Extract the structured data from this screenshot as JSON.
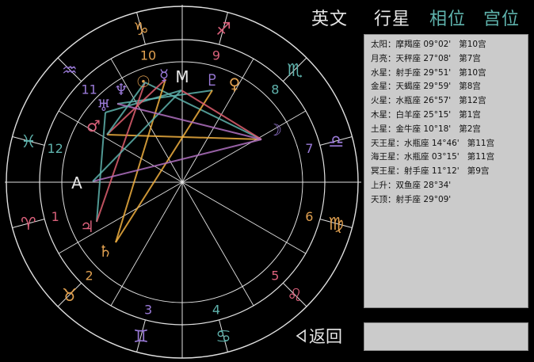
{
  "tabs": {
    "english": "英文",
    "planets": "行星",
    "aspects": "相位",
    "houses": "宫位"
  },
  "rows": [
    {
      "planet": "太阳",
      "sign": "摩羯座",
      "deg": "09°02'",
      "house": "第10宫"
    },
    {
      "planet": "月亮",
      "sign": "天秤座",
      "deg": "27°08'",
      "house": "第7宫"
    },
    {
      "planet": "水星",
      "sign": "射手座",
      "deg": "29°51'",
      "house": "第10宫"
    },
    {
      "planet": "金星",
      "sign": "天蝎座",
      "deg": "29°59'",
      "house": "第8宫"
    },
    {
      "planet": "火星",
      "sign": "水瓶座",
      "deg": "26°57'",
      "house": "第12宫"
    },
    {
      "planet": "木星",
      "sign": "白羊座",
      "deg": "25°15'",
      "house": "第1宫"
    },
    {
      "planet": "土星",
      "sign": "金牛座",
      "deg": "10°18'",
      "house": "第2宫"
    },
    {
      "planet": "天王星",
      "sign": "水瓶座",
      "deg": "14°46'",
      "house": "第11宫"
    },
    {
      "planet": "海王星",
      "sign": "水瓶座",
      "deg": "03°15'",
      "house": "第11宫"
    },
    {
      "planet": "冥王星",
      "sign": "射手座",
      "deg": "11°12'",
      "house": "第9宫"
    },
    {
      "planet": "上升",
      "sign": "双鱼座",
      "deg": "28°34'",
      "house": ""
    },
    {
      "planet": "天顶",
      "sign": "射手座",
      "deg": "29°09'",
      "house": ""
    }
  ],
  "back_label": "返回",
  "chart": {
    "house_numbers": [
      "1",
      "2",
      "3",
      "4",
      "5",
      "6",
      "7",
      "8",
      "9",
      "10",
      "11",
      "12"
    ],
    "angle_labels": {
      "asc": "A",
      "mc": "M"
    },
    "sign_glyphs": [
      "♈",
      "♉",
      "♊",
      "♋",
      "♌",
      "♍",
      "♎",
      "♏",
      "♐",
      "♑",
      "♒",
      "♓"
    ],
    "planet_glyphs": {
      "sun": "☉",
      "moon": "☽",
      "mercury": "☿",
      "venus": "♀",
      "mars": "♂",
      "jupiter": "♃",
      "saturn": "♄",
      "uranus": "♅",
      "neptune": "♆",
      "pluto": "♇"
    },
    "colors": {
      "wheel": "#e0e0e0",
      "sign_fire": "#d9607a",
      "sign_earth": "#e0a050",
      "sign_air": "#9a7ad8",
      "sign_water": "#5fb3ad",
      "aspect_orange": "#f0b040",
      "aspect_red": "#e06070",
      "aspect_teal": "#5fb3ad",
      "aspect_purple": "#b070c0",
      "accent": "#5fb3ad"
    }
  }
}
